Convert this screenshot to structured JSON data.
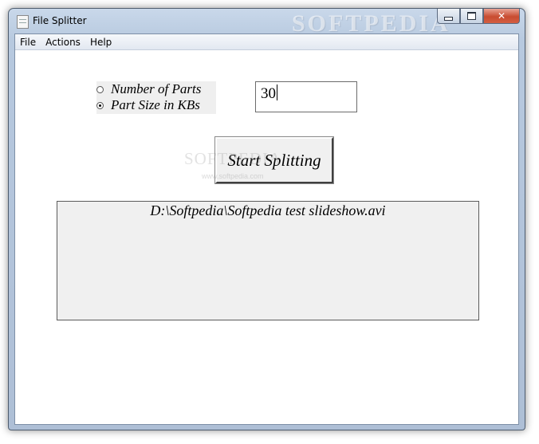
{
  "window": {
    "title": "File Splitter",
    "watermark": "SOFTPEDIA",
    "controls": {
      "minimize": "",
      "maximize": "",
      "close": "✕"
    }
  },
  "menu": [
    {
      "label": "File"
    },
    {
      "label": "Actions"
    },
    {
      "label": "Help"
    }
  ],
  "split_mode": {
    "options": [
      {
        "label": "Number of Parts",
        "checked": false
      },
      {
        "label": "Part Size in KBs",
        "checked": true
      }
    ]
  },
  "size_input": {
    "value": "30"
  },
  "start_button": {
    "label": "Start Splitting",
    "watermark": "SOFTPEDIA",
    "watermark_sub": "www.softpedia.com"
  },
  "output": {
    "text": "D:\\Softpedia\\Softpedia test slideshow.avi"
  }
}
